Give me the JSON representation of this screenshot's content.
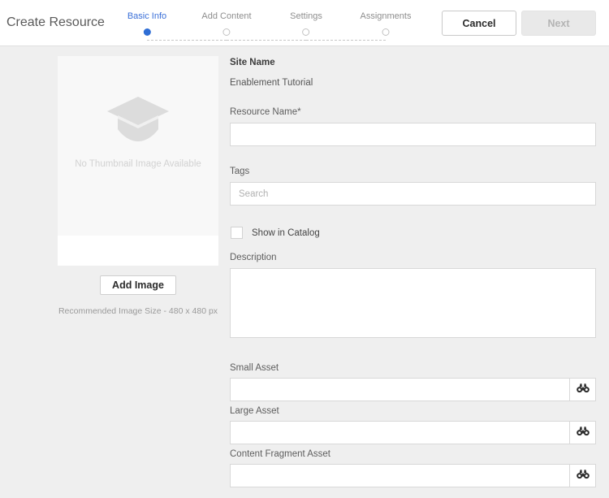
{
  "header": {
    "page_title": "Create Resource",
    "steps": [
      {
        "label": "Basic Info",
        "state": "active"
      },
      {
        "label": "Add Content",
        "state": "inactive"
      },
      {
        "label": "Settings",
        "state": "inactive"
      },
      {
        "label": "Assignments",
        "state": "inactive"
      }
    ],
    "cancel_label": "Cancel",
    "next_label": "Next",
    "active_color": "#3a6fd8",
    "active_dot_color": "#2f6ed5"
  },
  "thumbnail": {
    "placeholder_text": "No Thumbnail Image Available",
    "icon": "graduation-cap-icon",
    "add_image_label": "Add Image",
    "recommended_size": "Recommended Image Size - 480 x 480 px"
  },
  "form": {
    "site_name_label": "Site Name",
    "site_name_value": "Enablement Tutorial",
    "resource_name": {
      "label": "Resource Name*",
      "value": "",
      "placeholder": ""
    },
    "tags": {
      "label": "Tags",
      "value": "",
      "placeholder": "Search"
    },
    "show_in_catalog": {
      "label": "Show in Catalog",
      "checked": false
    },
    "description": {
      "label": "Description",
      "value": "",
      "placeholder": ""
    },
    "small_asset": {
      "label": "Small Asset",
      "value": "",
      "placeholder": "",
      "browse_icon": "binoculars-icon"
    },
    "large_asset": {
      "label": "Large Asset",
      "value": "",
      "placeholder": "",
      "browse_icon": "binoculars-icon"
    },
    "content_fragment_asset": {
      "label": "Content Fragment Asset",
      "value": "",
      "placeholder": "",
      "browse_icon": "binoculars-icon"
    }
  }
}
